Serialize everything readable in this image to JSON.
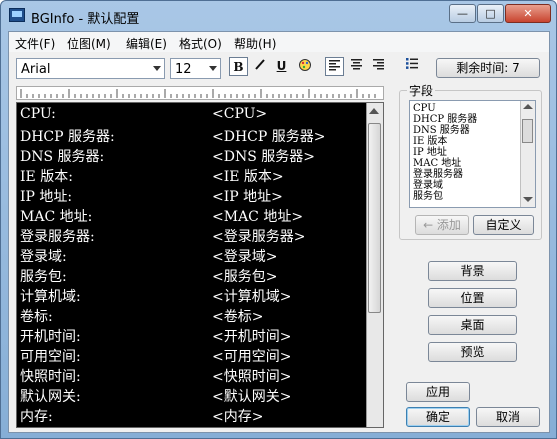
{
  "window": {
    "title": "BGInfo - 默认配置",
    "minimize": "—",
    "maximize": "□",
    "close": "✕"
  },
  "menu": [
    "文件(F)",
    "位图(M)",
    "编辑(E)",
    "格式(O)",
    "帮助(H)"
  ],
  "toolbar": {
    "font_name": "Arial",
    "font_size": "12",
    "bold": "B",
    "italic": "I",
    "underline": "U",
    "remaining_time": "剩余时间: 7"
  },
  "editor_lines": [
    {
      "label": "CPU:",
      "value": "<CPU>"
    },
    {
      "label": "DHCP 服务器:",
      "value": "<DHCP 服务器>"
    },
    {
      "label": "DNS 服务器:",
      "value": "<DNS 服务器>"
    },
    {
      "label": "IE 版本:",
      "value": "<IE 版本>"
    },
    {
      "label": "IP 地址:",
      "value": "<IP 地址>"
    },
    {
      "label": "MAC 地址:",
      "value": "<MAC 地址>"
    },
    {
      "label": "登录服务器:",
      "value": "<登录服务器>"
    },
    {
      "label": "登录域:",
      "value": "<登录域>"
    },
    {
      "label": "服务包:",
      "value": "<服务包>"
    },
    {
      "label": "计算机域:",
      "value": "<计算机域>"
    },
    {
      "label": "卷标:",
      "value": "<卷标>"
    },
    {
      "label": "开机时间:",
      "value": "<开机时间>"
    },
    {
      "label": "可用空间:",
      "value": "<可用空间>"
    },
    {
      "label": "快照时间:",
      "value": "<快照时间>"
    },
    {
      "label": "默认网关:",
      "value": "<默认网关>"
    },
    {
      "label": "内存:",
      "value": "<内存>"
    }
  ],
  "fields": {
    "label": "字段",
    "items": [
      "CPU",
      "DHCP 服务器",
      "DNS 服务器",
      "IE 版本",
      "IP 地址",
      "MAC 地址",
      "登录服务器",
      "登录域",
      "服务包"
    ],
    "add": "← 添加",
    "custom": "自定义"
  },
  "buttons": {
    "background": "背景",
    "position": "位置",
    "desktop": "桌面",
    "preview": "预览",
    "apply": "应用",
    "ok": "确定",
    "cancel": "取消"
  }
}
